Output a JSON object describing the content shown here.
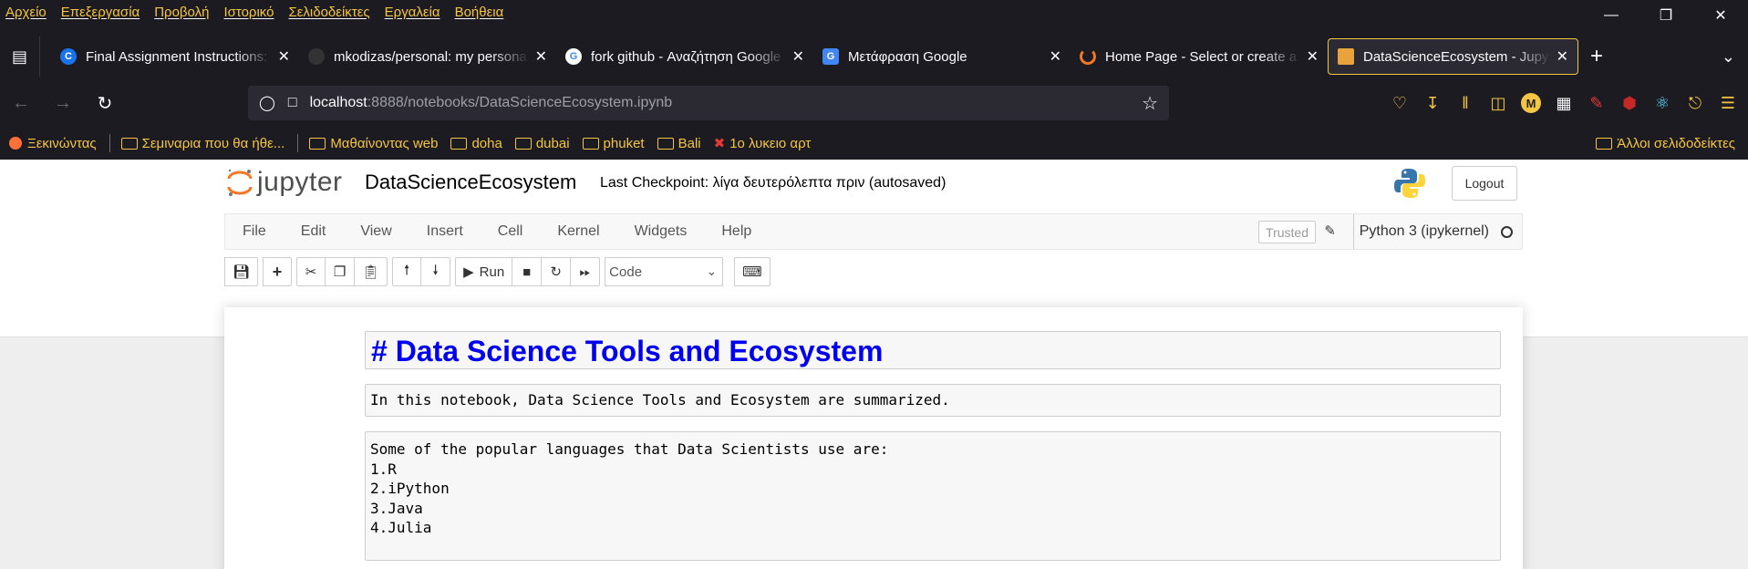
{
  "browser": {
    "menu": [
      "Αρχείο",
      "Επεξεργασία",
      "Προβολή",
      "Ιστορικό",
      "Σελιδοδείκτες",
      "Εργαλεία",
      "Βοήθεια"
    ],
    "tabs": [
      {
        "title": "Final Assignment Instructions: C",
        "favicon_color": "#1a73e8",
        "favicon_letter": "C"
      },
      {
        "title": "mkodizas/personal: my persona",
        "favicon_color": "#333333",
        "favicon_letter": ""
      },
      {
        "title": "fork github - Αναζήτηση Google",
        "favicon_color": "#ffffff",
        "favicon_letter": "G"
      },
      {
        "title": "Μετάφραση Google",
        "favicon_color": "#4285f4",
        "favicon_letter": "G"
      },
      {
        "title": "Home Page - Select or create a",
        "favicon_color": "#f37726",
        "favicon_letter": ""
      },
      {
        "title": "DataScienceEcosystem - Jupyter",
        "favicon_color": "#e8a33d",
        "favicon_letter": "",
        "active": true
      }
    ],
    "url_host": "localhost",
    "url_rest": ":8888/notebooks/DataScienceEcosystem.ipynb",
    "bookmarks": [
      "Ξεκινώντας",
      "Σεμιναρια που θα ήθε...",
      "Μαθαίνοντας web",
      "doha",
      "dubai",
      "phuket",
      "Bali",
      "1ο λυκειο αρτ"
    ],
    "other_bookmarks": "Άλλοι σελιδοδείκτες",
    "accent_color": "#f4c542"
  },
  "jupyter": {
    "logo_text": "jupyter",
    "notebook_name": "DataScienceEcosystem",
    "checkpoint": "Last Checkpoint: λίγα δευτερόλεπτα πριν   (autosaved)",
    "logout": "Logout",
    "menu": [
      "File",
      "Edit",
      "View",
      "Insert",
      "Cell",
      "Kernel",
      "Widgets",
      "Help"
    ],
    "trusted": "Trusted",
    "kernel": "Python 3 (ipykernel)",
    "run_label": "Run",
    "cell_type": "Code"
  },
  "cells": {
    "heading": "# Data Science Tools and Ecosystem",
    "intro": "In this notebook, Data Science Tools and Ecosystem are summarized.",
    "languages": {
      "intro": "Some of the popular languages that Data Scientists use are:",
      "items": [
        "1.R",
        "2.iPython",
        "3.Java",
        "4.Julia"
      ]
    }
  }
}
